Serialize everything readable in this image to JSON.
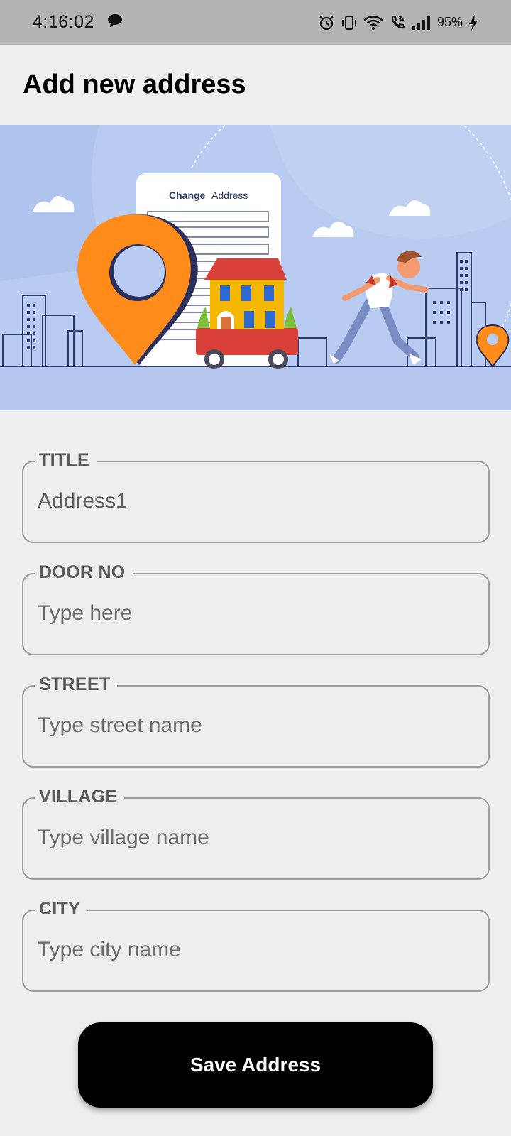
{
  "status_bar": {
    "time": "4:16:02",
    "battery": "95%",
    "icons": [
      "chat-icon",
      "alarm-icon",
      "vibrate-icon",
      "wifi-icon",
      "wifi-call-icon",
      "signal-icon",
      "charging-icon"
    ]
  },
  "header": {
    "title": "Add new address"
  },
  "illustration": {
    "caption_bold": "Change",
    "caption_rest": "Address"
  },
  "form": {
    "fields": [
      {
        "label": "TITLE",
        "value": "Address1",
        "placeholder": ""
      },
      {
        "label": "DOOR NO",
        "value": "",
        "placeholder": "Type here"
      },
      {
        "label": "STREET",
        "value": "",
        "placeholder": "Type street name"
      },
      {
        "label": "VILLAGE",
        "value": "",
        "placeholder": "Type village name"
      },
      {
        "label": "CITY",
        "value": "",
        "placeholder": "Type city name"
      }
    ],
    "save_label": "Save Address"
  },
  "colors": {
    "accent_orange": "#ff8c1a",
    "illustration_bg": "#b6c9ef",
    "button_bg": "#000000"
  }
}
